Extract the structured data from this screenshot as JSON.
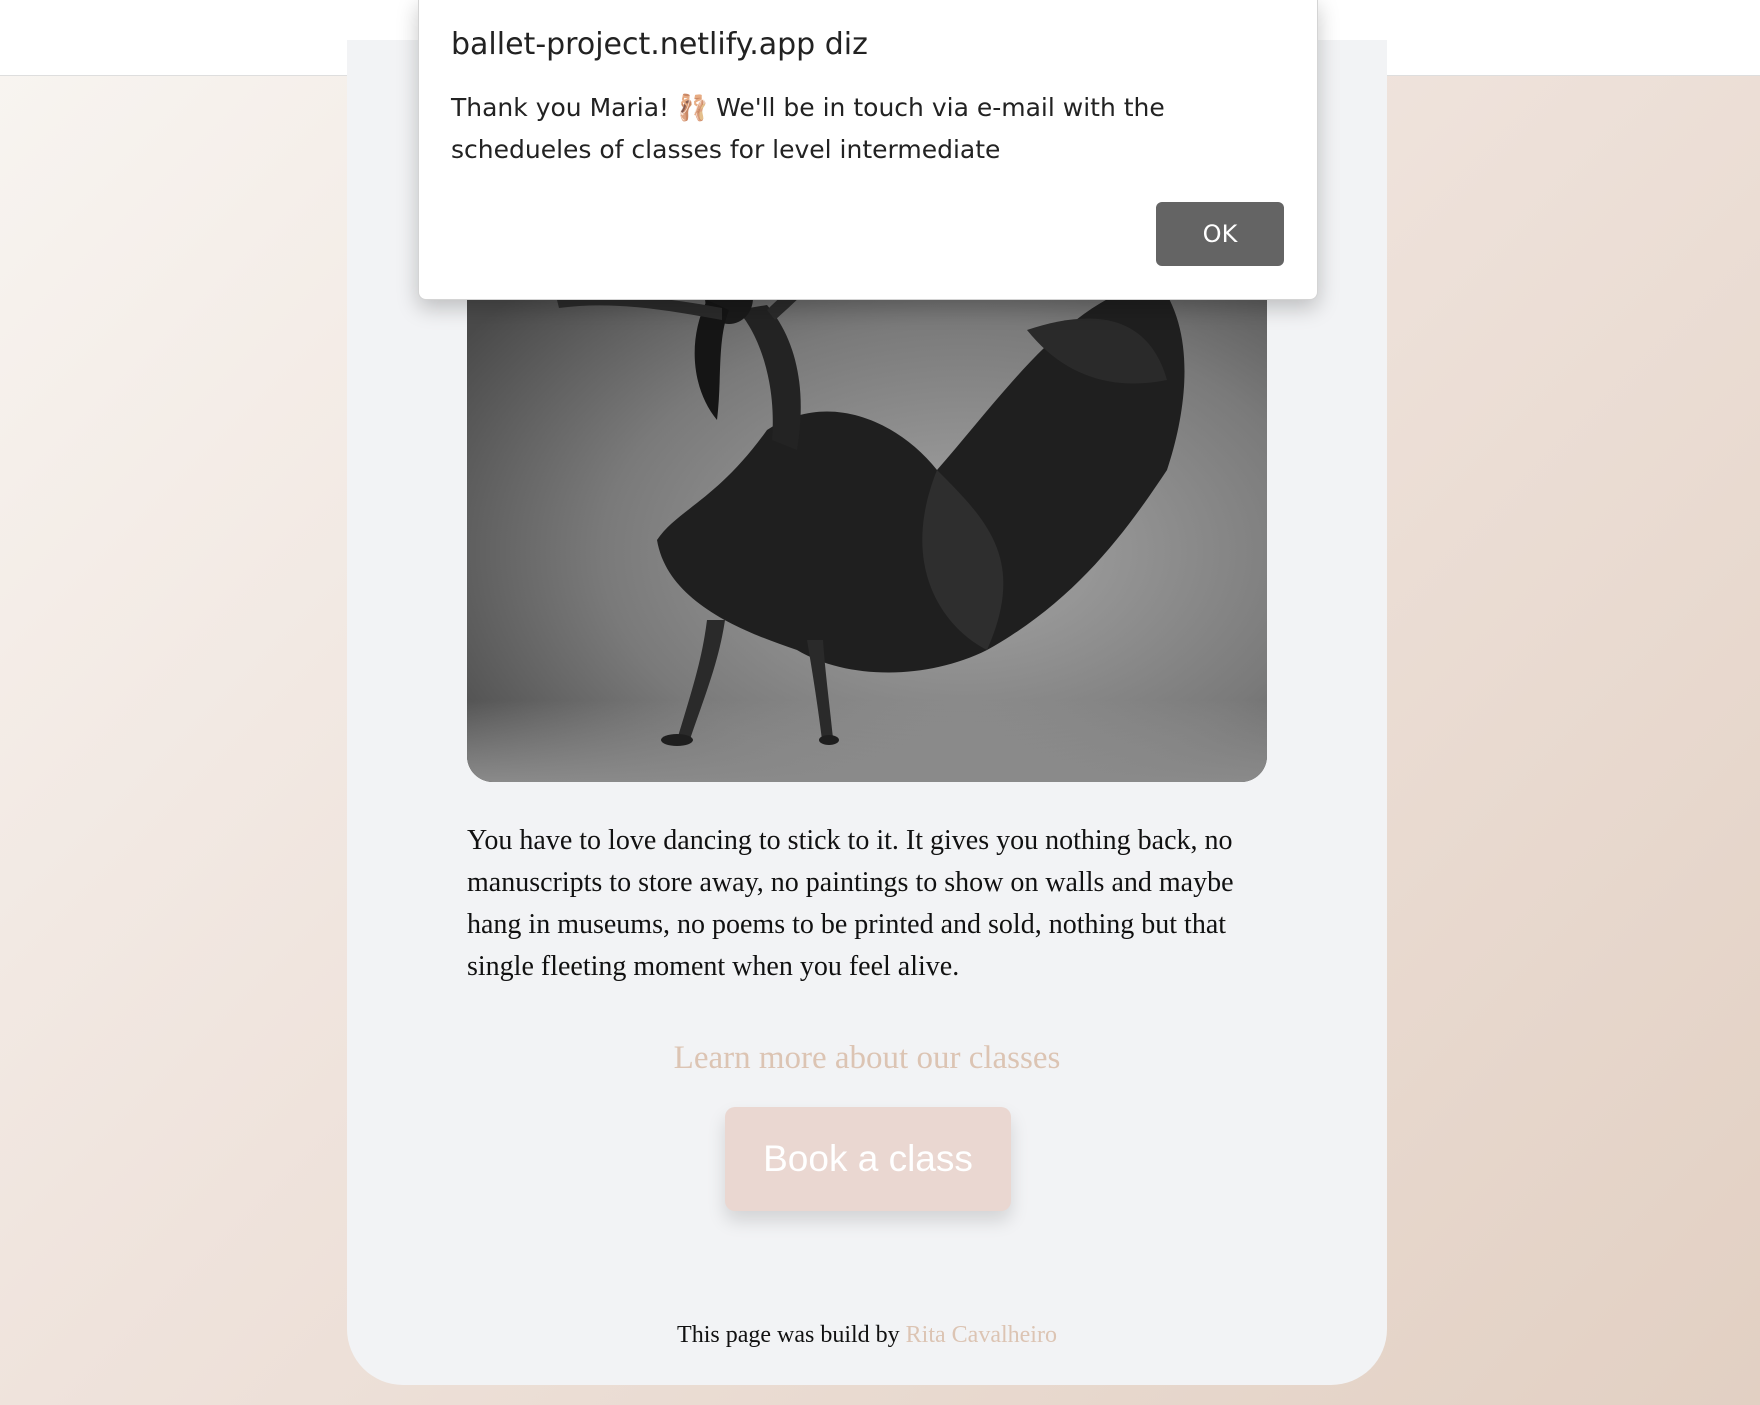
{
  "dialog": {
    "title": "ballet-project.netlify.app diz",
    "message": "Thank you Maria! 🩰  We'll be in touch via e-mail with the schedueles of classes for level intermediate",
    "ok_label": "OK"
  },
  "main": {
    "quote": "You have to love dancing to stick to it. It gives you nothing back, no manuscripts to store away, no paintings to show on walls and maybe hang in museums, no poems to be printed and sold, nothing but that single fleeting moment when you feel alive.",
    "learn_more_link": "Learn more about our classes",
    "book_button": "Book a class"
  },
  "footer": {
    "text": "This page was build by",
    "author": "Rita Cavalheiro"
  },
  "colors": {
    "link": "#dcc4b3",
    "button_bg": "#ead7d1",
    "card_bg": "#f2f3f5",
    "ok_button_bg": "#646464"
  },
  "images": {
    "hero": "dancer-photo"
  }
}
